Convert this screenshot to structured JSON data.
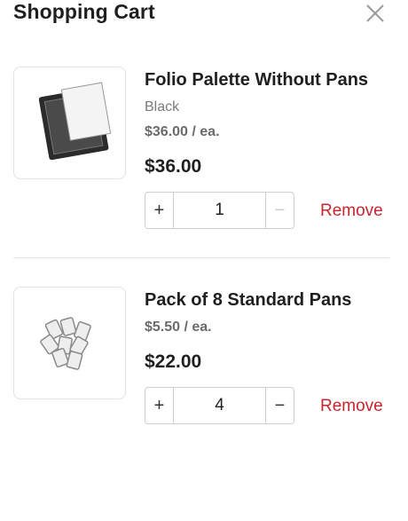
{
  "header": {
    "title": "Shopping Cart"
  },
  "cart": {
    "items": [
      {
        "name": "Folio Palette Without Pans",
        "variant": "Black",
        "unit_price": "$36.00 / ea.",
        "total": "$36.00",
        "quantity": "1",
        "minus_enabled": false,
        "remove_label": "Remove",
        "image_icon": "palette-image"
      },
      {
        "name": "Pack of 8 Standard Pans",
        "unit_price": "$5.50 / ea.",
        "total": "$22.00",
        "quantity": "4",
        "minus_enabled": true,
        "remove_label": "Remove",
        "image_icon": "pans-image"
      }
    ]
  },
  "colors": {
    "remove": "#c8262e",
    "border": "#cfcfcf"
  }
}
